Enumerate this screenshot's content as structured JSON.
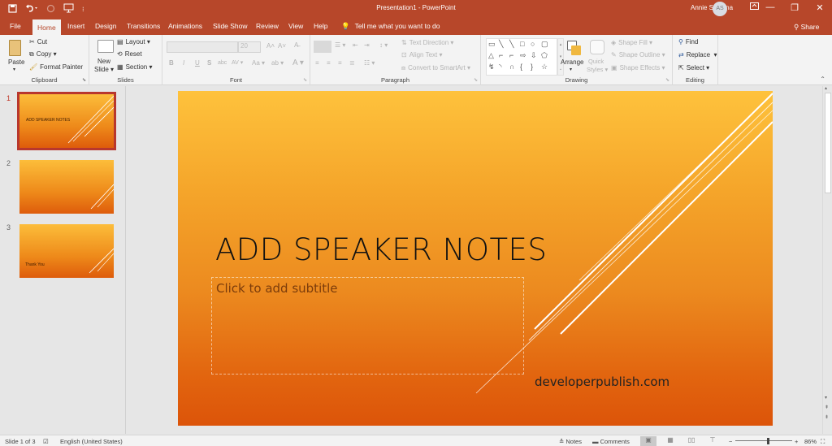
{
  "app": {
    "window_title": "Presentation1  -  PowerPoint",
    "user_name": "Annie Sanjana",
    "user_initials": "AS",
    "brand_color": "#b7472a"
  },
  "qat": {
    "save_icon": "save-icon",
    "undo_icon": "undo-icon",
    "redo_icon": "redo-icon",
    "start_from_beginning_icon": "presenter-icon",
    "customize_icon": "customize-qat-icon"
  },
  "window_controls": {
    "ribbon_display": "ribbon-display-icon",
    "minimize": "—",
    "restore": "❐",
    "close": "✕"
  },
  "tabs": [
    {
      "label": "File"
    },
    {
      "label": "Home",
      "active": true
    },
    {
      "label": "Insert"
    },
    {
      "label": "Design"
    },
    {
      "label": "Transitions"
    },
    {
      "label": "Animations"
    },
    {
      "label": "Slide Show"
    },
    {
      "label": "Review"
    },
    {
      "label": "View"
    },
    {
      "label": "Help"
    }
  ],
  "tell_me": "Tell me what you want to do",
  "share_label": "Share",
  "ribbon": {
    "clipboard": {
      "label": "Clipboard",
      "paste": "Paste",
      "cut": "Cut",
      "copy": "Copy",
      "format_painter": "Format Painter"
    },
    "slides": {
      "label": "Slides",
      "new_slide_line1": "New",
      "new_slide_line2": "Slide",
      "layout": "Layout",
      "reset": "Reset",
      "section": "Section"
    },
    "font": {
      "label": "Font",
      "font_name": "",
      "font_size": "20",
      "bold": "B",
      "italic": "I",
      "underline": "U",
      "shadow": "S",
      "strikethrough": "abc",
      "spacing": "AV",
      "change_case": "Aa",
      "font_color": "A",
      "grow": "A˄",
      "shrink": "A˅"
    },
    "paragraph": {
      "label": "Paragraph",
      "text_direction": "Text Direction",
      "align_text": "Align Text",
      "convert_smartart": "Convert to SmartArt"
    },
    "drawing": {
      "label": "Drawing",
      "arrange": "Arrange",
      "quick_styles_line1": "Quick",
      "quick_styles_line2": "Styles",
      "shape_fill": "Shape Fill",
      "shape_outline": "Shape Outline",
      "shape_effects": "Shape Effects",
      "shapes": [
        "▭",
        "╲",
        "╲",
        "□",
        "○",
        "▢",
        "△",
        "⌐",
        "⌐",
        "⇨",
        "⇩",
        "⬠",
        "↯",
        "◝",
        "∩",
        "{",
        "}",
        "☆"
      ]
    },
    "editing": {
      "label": "Editing",
      "find": "Find",
      "replace": "Replace",
      "select": "Select"
    }
  },
  "thumbnails": [
    {
      "number": "1",
      "text": "ADD SPEAKER NOTES",
      "selected": true
    },
    {
      "number": "2",
      "text": ""
    },
    {
      "number": "3",
      "text": "Thank You"
    }
  ],
  "slide": {
    "title": "ADD SPEAKER NOTES",
    "subtitle_placeholder": "Click to add subtitle",
    "website": "developerpublish.com"
  },
  "status": {
    "slide_counter": "Slide 1 of 3",
    "language": "English (United States)",
    "notes": "Notes",
    "comments": "Comments",
    "zoom_percent": "86%",
    "zoom_minus": "−",
    "zoom_plus": "+",
    "zoom_level": 0.57
  }
}
